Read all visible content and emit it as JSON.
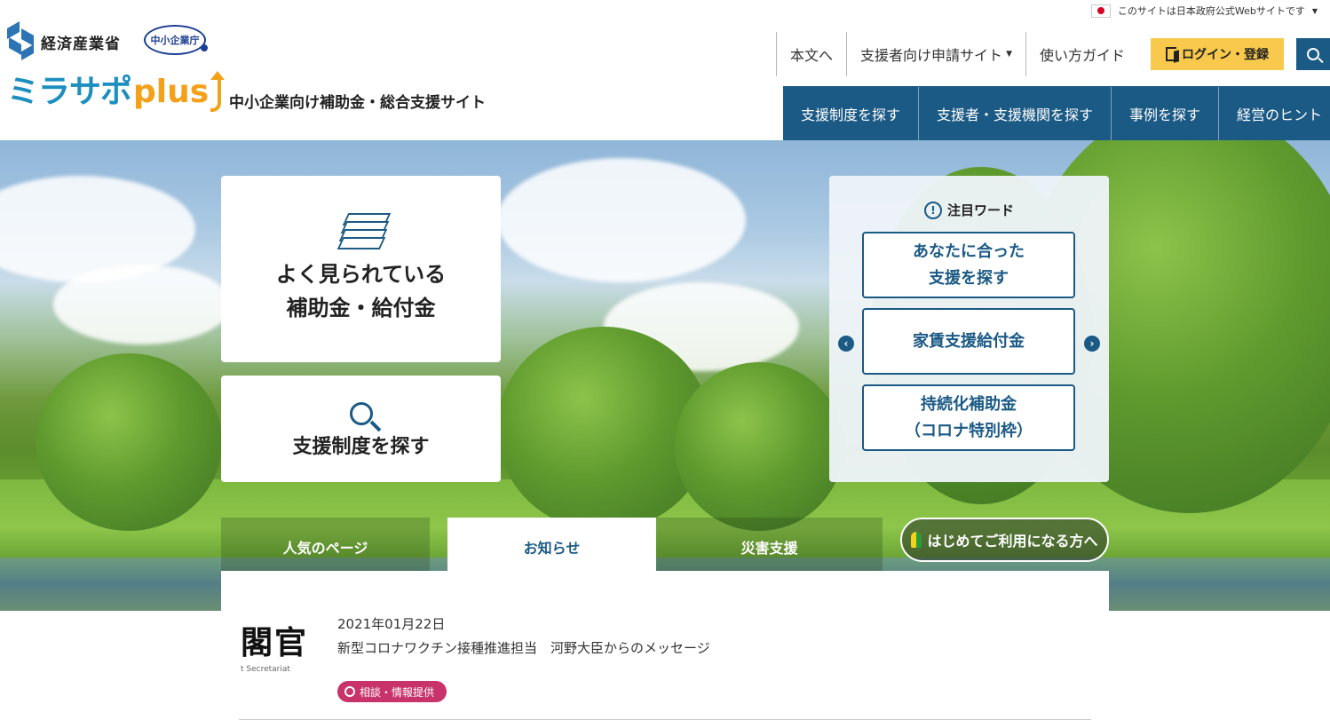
{
  "gov_notice": {
    "text": "このサイトは日本政府公式Webサイトです"
  },
  "logos": {
    "meti": "経済産業省",
    "sme_agency": "中小企業庁",
    "brand": "ミラサポ",
    "brand_plus": "plus",
    "tagline": "中小企業向け補助金・総合支援サイト"
  },
  "utility_nav": {
    "skip": "本文へ",
    "supporter_site": "支援者向け申請サイト",
    "guide": "使い方ガイド",
    "login": "ログイン・登録"
  },
  "main_nav": [
    {
      "label": "支援制度を探す"
    },
    {
      "label": "支援者・支援機関を探す"
    },
    {
      "label": "事例を探す"
    },
    {
      "label": "経営のヒント"
    }
  ],
  "hero": {
    "popular_card": {
      "line1": "よく見られている",
      "line2": "補助金・給付金"
    },
    "search_card": {
      "label": "支援制度を探す"
    },
    "focus": {
      "heading": "注目ワード",
      "items": [
        {
          "label": "あなたに合った\n支援を探す"
        },
        {
          "label": "家賃支援給付金"
        },
        {
          "label": "持続化補助金\n（コロナ特別枠）"
        }
      ]
    }
  },
  "tabs": [
    {
      "label": "人気のページ"
    },
    {
      "label": "お知らせ"
    },
    {
      "label": "災害支援"
    }
  ],
  "beginner_button": {
    "label": "はじめてご利用になる方へ"
  },
  "news": {
    "thumb_kanji": "閣官",
    "thumb_sub": "t Secretariat",
    "date": "2021年01月22日",
    "title": "新型コロナワクチン接種推進担当　河野大臣からのメッセージ",
    "tag": "相談・情報提供"
  },
  "colors": {
    "primary": "#1b5a85",
    "accent_yellow": "#f8c94d",
    "brand_blue": "#1c8fc0",
    "brand_orange": "#f3a01a",
    "tag_pink": "#c8336b"
  }
}
